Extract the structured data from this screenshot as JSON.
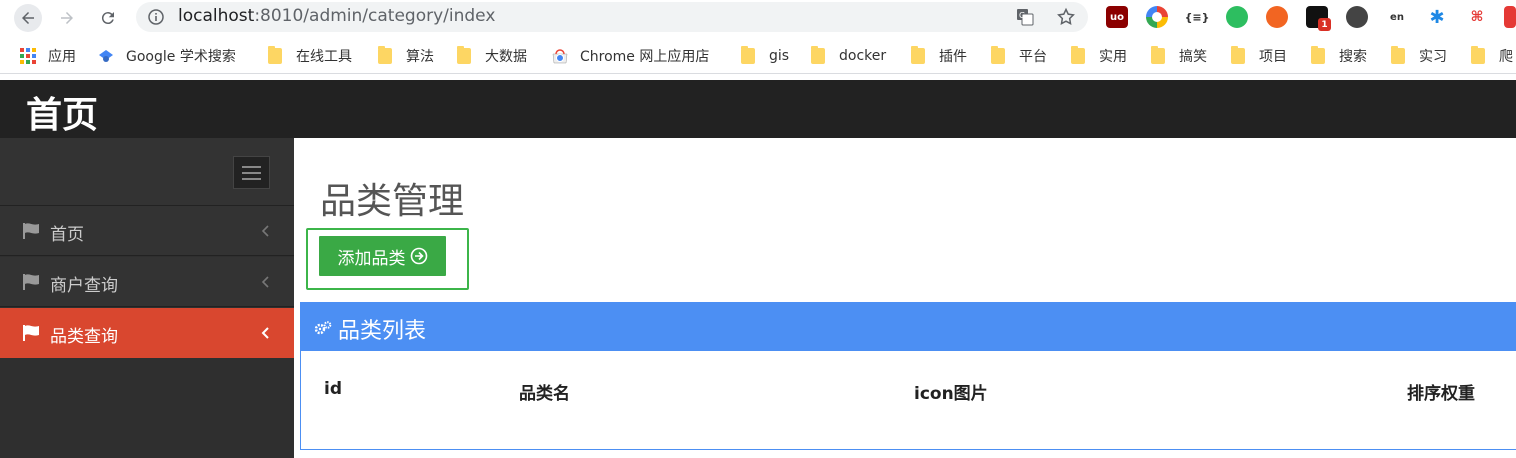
{
  "browser": {
    "url_host": "localhost",
    "url_rest": ":8010/admin/category/index",
    "extension_badge": "1"
  },
  "bookmarks": [
    {
      "label": "应用",
      "icon": "apps-grid-icon"
    },
    {
      "label": "Google 学术搜索",
      "icon": "scholar-icon"
    },
    {
      "label": "在线工具",
      "icon": "folder-icon"
    },
    {
      "label": "算法",
      "icon": "folder-icon"
    },
    {
      "label": "大数据",
      "icon": "folder-icon"
    },
    {
      "label": "Chrome 网上应用店",
      "icon": "chrome-webstore-icon"
    },
    {
      "label": "gis",
      "icon": "folder-icon"
    },
    {
      "label": "docker",
      "icon": "folder-icon"
    },
    {
      "label": "插件",
      "icon": "folder-icon"
    },
    {
      "label": "平台",
      "icon": "folder-icon"
    },
    {
      "label": "实用",
      "icon": "folder-icon"
    },
    {
      "label": "搞笑",
      "icon": "folder-icon"
    },
    {
      "label": "项目",
      "icon": "folder-icon"
    },
    {
      "label": "搜索",
      "icon": "folder-icon"
    },
    {
      "label": "实习",
      "icon": "folder-icon"
    },
    {
      "label": "爬",
      "icon": "folder-icon"
    }
  ],
  "header": {
    "title": "首页"
  },
  "sidebar": {
    "items": [
      {
        "label": "首页",
        "icon": "flag-icon",
        "active": false
      },
      {
        "label": "商户查询",
        "icon": "flag-icon",
        "active": false
      },
      {
        "label": "品类查询",
        "icon": "flag-icon",
        "active": true
      }
    ]
  },
  "main": {
    "page_title": "品类管理",
    "add_button_label": "添加品类",
    "panel_title": "品类列表",
    "columns": [
      "id",
      "品类名",
      "icon图片",
      "排序权重"
    ]
  },
  "colors": {
    "header_bg": "#222222",
    "sidebar_bg": "#333333",
    "active_item": "#d9472f",
    "add_button": "#3aa945",
    "highlight_border": "#3cb54a",
    "panel_heading": "#4c8ff3"
  }
}
